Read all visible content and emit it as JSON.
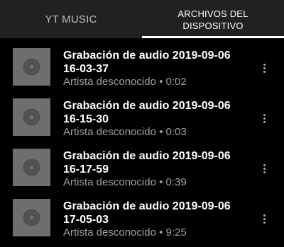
{
  "tabs": [
    {
      "label": "YT MUSIC",
      "selected": false
    },
    {
      "label": "ARCHIVOS DEL DISPOSITIVO",
      "selected": true
    }
  ],
  "items": [
    {
      "title": "Grabación de audio 2019-09-06 16-03-37",
      "subtitle": "Artista desconocido • 0:02"
    },
    {
      "title": "Grabación de audio 2019-09-06 16-15-30",
      "subtitle": "Artista desconocido • 0:03"
    },
    {
      "title": "Grabación de audio 2019-09-06 16-17-59",
      "subtitle": "Artista desconocido • 0:39"
    },
    {
      "title": "Grabación de audio 2019-09-06 17-05-03",
      "subtitle": "Artista desconocido • 9:25"
    }
  ],
  "icons": {
    "thumbnail": "vinyl-disc-icon",
    "more": "more-vert-icon"
  },
  "colors": {
    "tab_bar_bg": "#212121",
    "background": "#000000",
    "indicator": "#ffffff",
    "thumbnail_bg": "#6e6e6e",
    "subtitle": "#a0a0a0"
  }
}
